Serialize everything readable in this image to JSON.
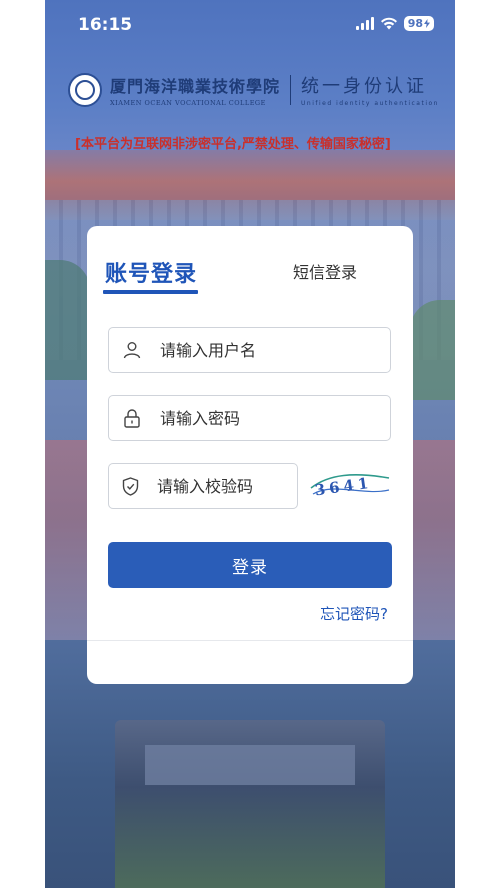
{
  "status_bar": {
    "time": "16:15",
    "battery": "98"
  },
  "header": {
    "school_name_cn": "厦門海洋職業技術學院",
    "school_name_en": "XIAMEN OCEAN VOCATIONAL COLLEGE",
    "portal_title_cn": "统一身份认证",
    "portal_title_en": "Unified identity authentication",
    "warning": "[本平台为互联网非涉密平台,严禁处理、传输国家秘密]"
  },
  "login_card": {
    "tab_account": "账号登录",
    "tab_sms": "短信登录",
    "username_placeholder": "请输入用户名",
    "password_placeholder": "请输入密码",
    "captcha_placeholder": "请输入校验码",
    "captcha_text": "3641",
    "login_button": "登录",
    "forgot_password": "忘记密码?"
  },
  "colors": {
    "accent": "#2a5db8",
    "warning": "#c9302c"
  }
}
